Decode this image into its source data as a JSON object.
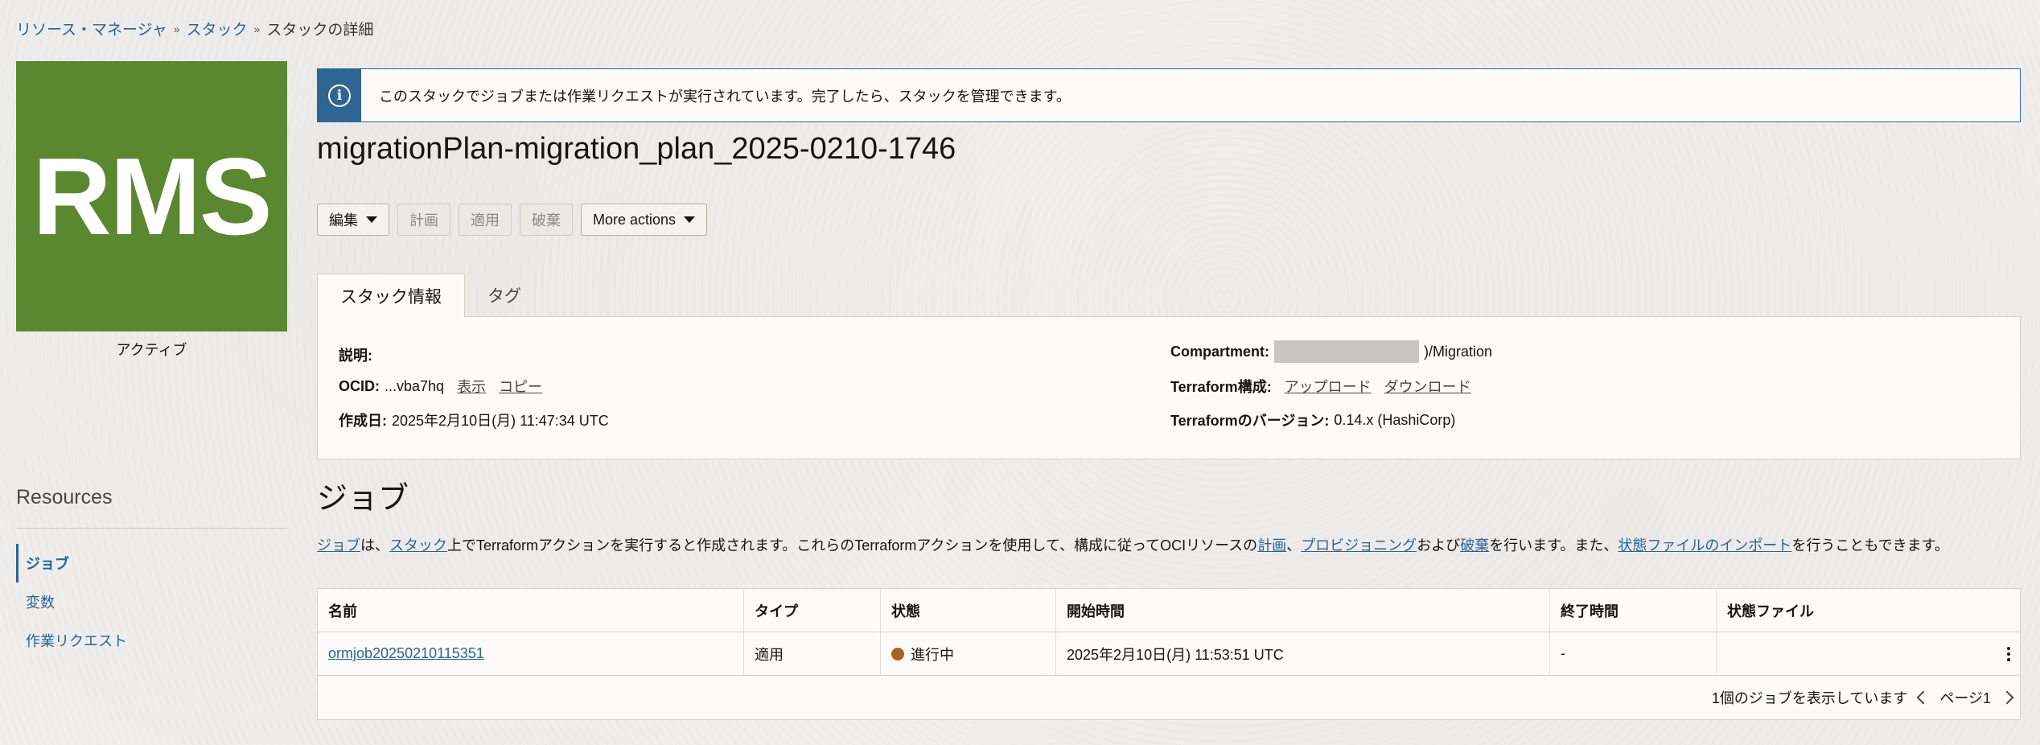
{
  "breadcrumb": {
    "items": [
      "リソース・マネージャ",
      "スタック"
    ],
    "current": "スタックの詳細"
  },
  "stack": {
    "icon_text": "RMS",
    "icon_color": "#5b8731",
    "status": "アクティブ"
  },
  "resources": {
    "title": "Resources",
    "items": [
      "ジョブ",
      "変数",
      "作業リクエスト"
    ],
    "active": "ジョブ"
  },
  "banner": {
    "icon": "info-icon",
    "message": "このスタックでジョブまたは作業リクエストが実行されています。完了したら、スタックを管理できます。"
  },
  "title": "migrationPlan-migration_plan_2025-0210-1746",
  "toolbar": {
    "edit": "編集",
    "plan": "計画",
    "apply": "適用",
    "destroy": "破棄",
    "more": "More actions"
  },
  "tabs": [
    "スタック情報",
    "タグ"
  ],
  "info": {
    "description_label": "説明:",
    "ocid_label": "OCID:",
    "ocid_value": "...vba7hq",
    "ocid_show": "表示",
    "ocid_copy": "コピー",
    "created_label": "作成日:",
    "created_value": "2025年2月10日(月) 11:47:34 UTC",
    "compartment_label": "Compartment:",
    "compartment_value": ")/Migration",
    "tf_config_label": "Terraform構成:",
    "tf_upload": "アップロード",
    "tf_download": "ダウンロード",
    "tf_version_label": "Terraformのバージョン:",
    "tf_version_value": "0.14.x (HashiCorp)"
  },
  "jobs": {
    "title": "ジョブ",
    "desc": {
      "l1": "ジョブ",
      "t1": "は、",
      "l2": "スタック",
      "t2": "上でTerraformアクションを実行すると作成されます。これらのTerraformアクションを使用して、構成に従ってOCIリソースの",
      "l3": "計画",
      "t3": "、",
      "l4": "プロビジョニング",
      "t4": "および",
      "l5": "破棄",
      "t5": "を行います。また、",
      "l6": "状態ファイルのインポート",
      "t6": "を行うこともできます。"
    },
    "columns": [
      "名前",
      "タイプ",
      "状態",
      "開始時間",
      "終了時間",
      "状態ファイル"
    ],
    "rows": [
      {
        "name": "ormjob20250210115351",
        "type": "適用",
        "state": "進行中",
        "state_color": "#a5651f",
        "start": "2025年2月10日(月) 11:53:51 UTC",
        "end": "-",
        "state_file": ""
      }
    ],
    "footer_count": "1個のジョブを表示しています",
    "page": "ページ1"
  }
}
